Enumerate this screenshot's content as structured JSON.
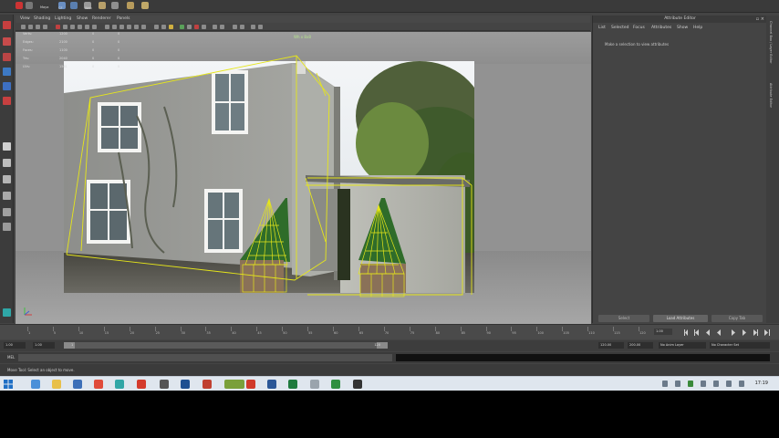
{
  "shelf": {
    "labels": [
      "Maya",
      "CF",
      "Web"
    ]
  },
  "viewport": {
    "menu": [
      "View",
      "Shading",
      "Lighting",
      "Show",
      "Renderer",
      "Panels"
    ],
    "camera_label": "Wh x 8x8",
    "hud_rows": [
      {
        "label": "Verts:",
        "a": "1200",
        "b": "0",
        "c": "0"
      },
      {
        "label": "Edges:",
        "a": "2100",
        "b": "0",
        "c": "0"
      },
      {
        "label": "Faces:",
        "a": "1100",
        "b": "0",
        "c": "0"
      },
      {
        "label": "Tris:",
        "a": "2040",
        "b": "0",
        "c": "0"
      },
      {
        "label": "UVs:",
        "a": "1561",
        "b": "0",
        "c": "0"
      }
    ]
  },
  "attribute_editor": {
    "title": "Attribute Editor",
    "menu": [
      "List",
      "Selected",
      "Focus",
      "Attributes",
      "Show",
      "Help"
    ],
    "message": "Make a selection to view attributes",
    "buttons": [
      "Select",
      "Load Attributes",
      "Copy Tab"
    ]
  },
  "side_tabs": [
    "Channel Box / Layer Editor",
    "Attribute Editor"
  ],
  "timeline": {
    "ticks": [
      "1",
      "5",
      "10",
      "15",
      "20",
      "25",
      "30",
      "35",
      "40",
      "45",
      "50",
      "55",
      "60",
      "65",
      "70",
      "75",
      "80",
      "85",
      "90",
      "95",
      "100",
      "105",
      "110",
      "115",
      "120"
    ],
    "current_frame": "1.00"
  },
  "range": {
    "start": "1.00",
    "start2": "1.00",
    "slider_start": "1",
    "slider_end": "120",
    "end": "120.00",
    "end2": "200.00",
    "anim_layer": "No Anim Layer",
    "char_set": "No Character Set"
  },
  "command_line": {
    "label": "MEL"
  },
  "help_line": {
    "text": "Move Tool: Select an object to move."
  },
  "taskbar": {
    "clock": "17:19"
  },
  "colors": {
    "wireframe": "#e6e61a",
    "app_bg": "#444444",
    "taskbar": "#dfe6ee"
  }
}
